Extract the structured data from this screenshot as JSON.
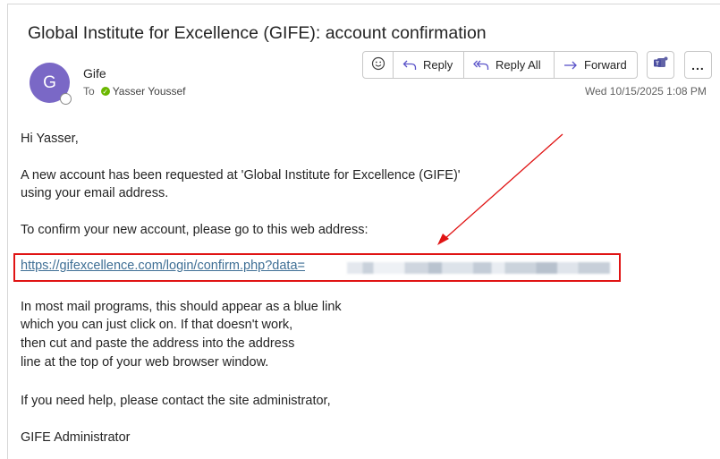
{
  "email": {
    "subject": "Global Institute for Excellence (GIFE): account confirmation",
    "sender_initial": "G",
    "sender_name": "Gife",
    "to_label": "To",
    "recipient": "Yasser  Youssef",
    "date": "Wed 10/15/2025 1:08 PM"
  },
  "toolbar": {
    "reply_label": "Reply",
    "reply_all_label": "Reply All",
    "forward_label": "Forward",
    "more_label": "..."
  },
  "body": {
    "greeting": "Hi Yasser,",
    "para1_line1": "A new account has been requested at 'Global Institute for Excellence (GIFE)'",
    "para1_line2": "using your email address.",
    "para2": "To confirm your new account, please go to this web address:",
    "link": "https://gifexcellence.com/login/confirm.php?data=",
    "para3_line1": "In most mail programs, this should appear as a blue link",
    "para3_line2": "which you can just click on. If that doesn't work,",
    "para3_line3": "then cut and paste the address into the address",
    "para3_line4": "line at the top of your web browser window.",
    "para4": "If you need help, please contact the site administrator,",
    "signature": "GIFE Administrator"
  },
  "annotation": {
    "highlight_color": "#e01414"
  },
  "icons": [
    "emoji-icon",
    "reply-icon",
    "reply-all-icon",
    "forward-icon",
    "teams-icon",
    "more-icon",
    "check-icon"
  ]
}
